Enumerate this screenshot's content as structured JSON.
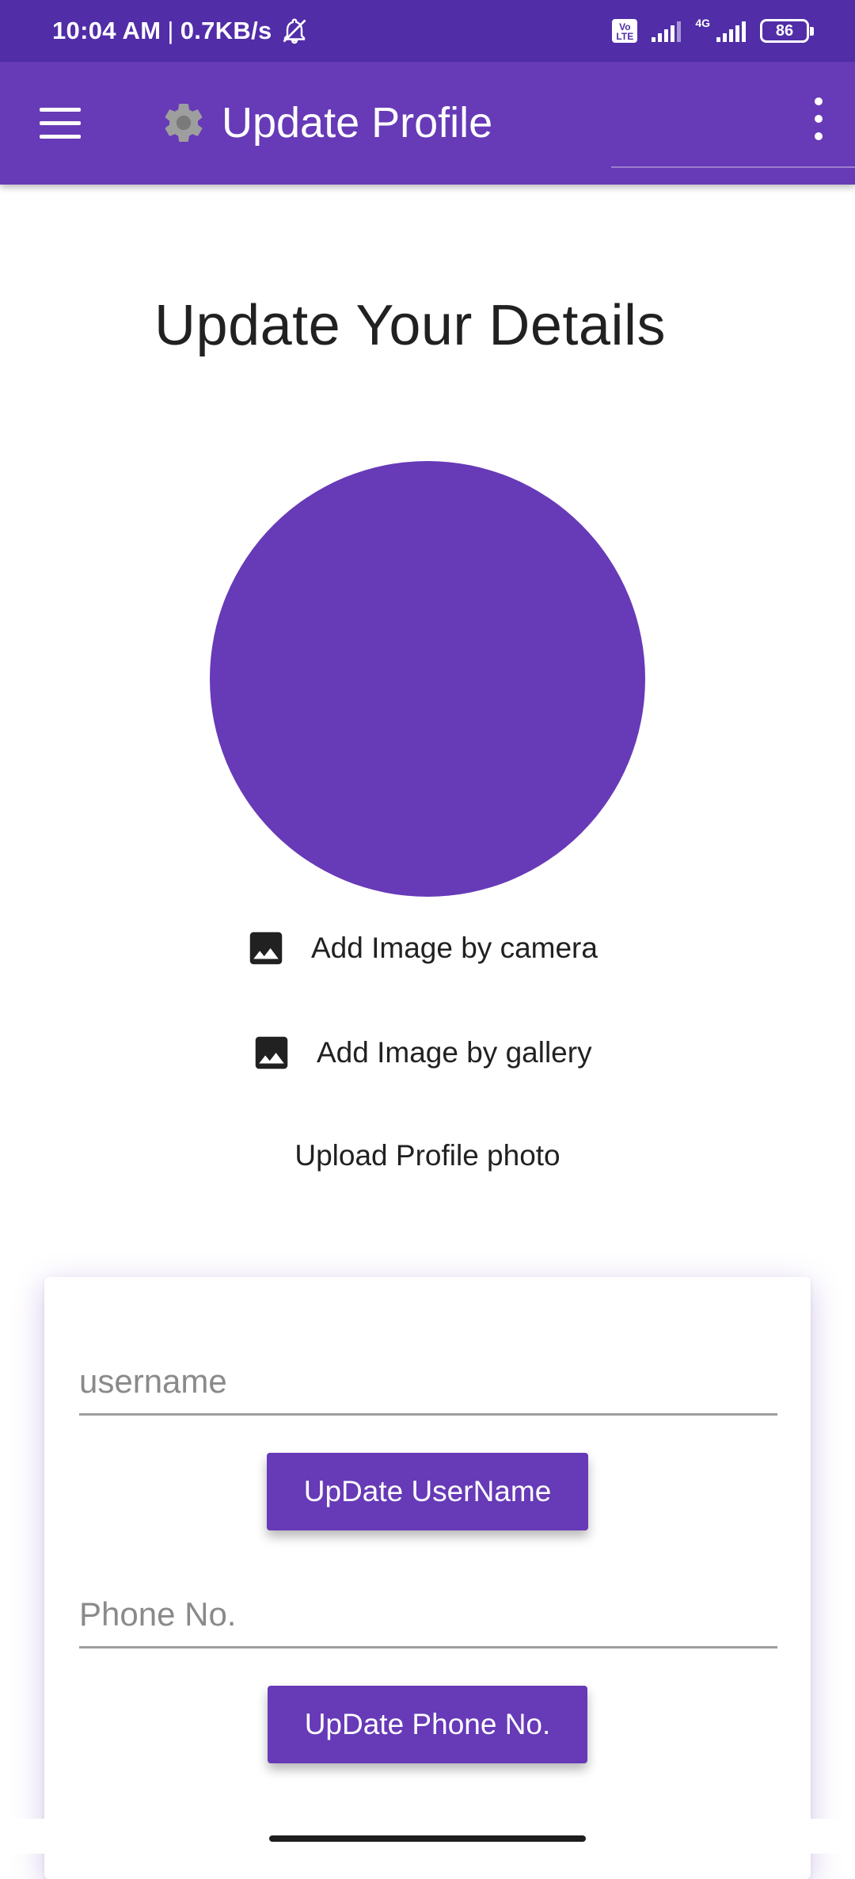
{
  "status_bar": {
    "time": "10:04 AM",
    "separator": "|",
    "speed": "0.7KB/s",
    "volte_line1": "Vo",
    "volte_line2": "LTE",
    "network_type": "4G",
    "battery": "86"
  },
  "app_bar": {
    "title": "Update Profile",
    "icons": [
      "menu-icon",
      "gear-icon",
      "more-vert-icon"
    ]
  },
  "main": {
    "heading": "Update Your Details",
    "avatar_color": "#673ab7",
    "add_camera_label": "Add Image by camera",
    "add_gallery_label": "Add Image by gallery",
    "upload_label": "Upload Profile photo"
  },
  "form": {
    "username_placeholder": "username",
    "username_value": "",
    "update_username_label": "UpDate UserName",
    "phone_placeholder": "Phone No.",
    "phone_value": "",
    "update_phone_label": "UpDate Phone No."
  },
  "colors": {
    "primary": "#673ab7",
    "primary_dark": "#512da8"
  }
}
